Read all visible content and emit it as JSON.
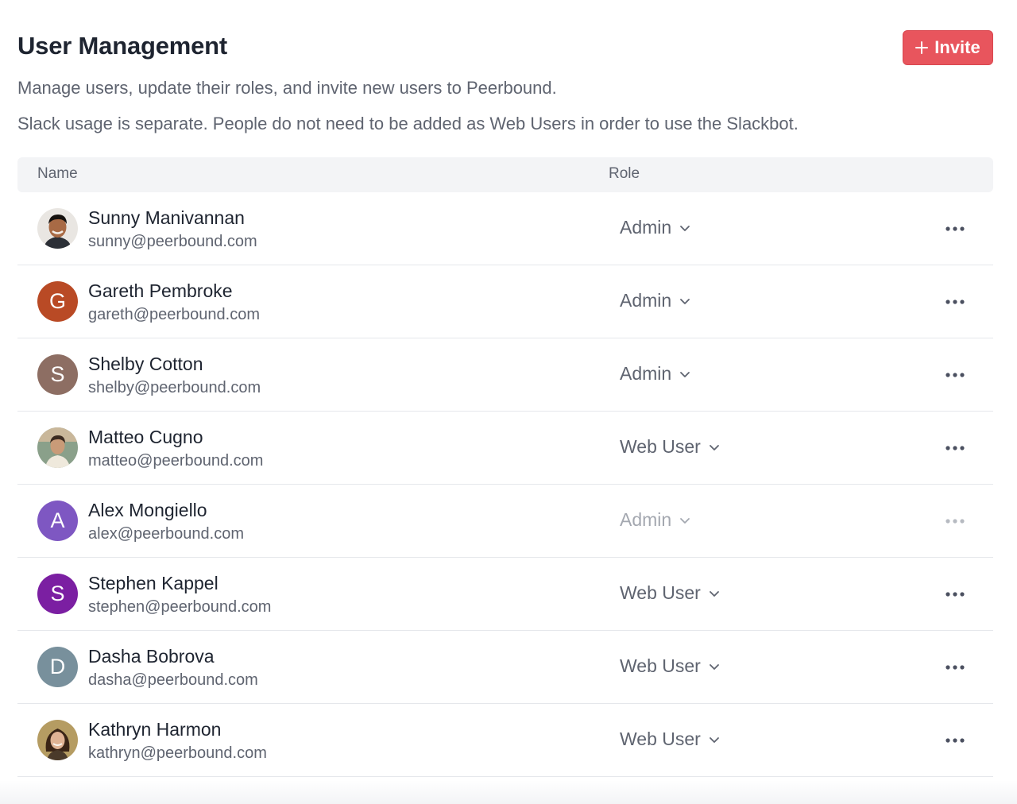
{
  "header": {
    "title": "User Management",
    "invite_label": "Invite",
    "subtitle": "Manage users, update their roles, and invite new users to Peerbound.",
    "note": "Slack usage is separate. People do not need to be added as Web Users in order to use the Slackbot."
  },
  "table": {
    "columns": {
      "name": "Name",
      "role": "Role"
    },
    "rows": [
      {
        "name": "Sunny Manivannan",
        "email": "sunny@peerbound.com",
        "role": "Admin",
        "avatar_type": "photo",
        "avatar_icon": "person-photo-icon",
        "disabled": false
      },
      {
        "name": "Gareth Pembroke",
        "email": "gareth@peerbound.com",
        "role": "Admin",
        "avatar_type": "initial",
        "avatar_initial": "G",
        "avatar_color": "#b94a25",
        "disabled": false
      },
      {
        "name": "Shelby Cotton",
        "email": "shelby@peerbound.com",
        "role": "Admin",
        "avatar_type": "initial",
        "avatar_initial": "S",
        "avatar_color": "#8d6e63",
        "disabled": false
      },
      {
        "name": "Matteo Cugno",
        "email": "matteo@peerbound.com",
        "role": "Web User",
        "avatar_type": "photo",
        "avatar_icon": "person-photo-icon",
        "disabled": false
      },
      {
        "name": "Alex Mongiello",
        "email": "alex@peerbound.com",
        "role": "Admin",
        "avatar_type": "initial",
        "avatar_initial": "A",
        "avatar_color": "#7e57c2",
        "disabled": true
      },
      {
        "name": "Stephen Kappel",
        "email": "stephen@peerbound.com",
        "role": "Web User",
        "avatar_type": "initial",
        "avatar_initial": "S",
        "avatar_color": "#7b1fa2",
        "disabled": false
      },
      {
        "name": "Dasha Bobrova",
        "email": "dasha@peerbound.com",
        "role": "Web User",
        "avatar_type": "initial",
        "avatar_initial": "D",
        "avatar_color": "#78909c",
        "disabled": false
      },
      {
        "name": "Kathryn Harmon",
        "email": "kathryn@peerbound.com",
        "role": "Web User",
        "avatar_type": "photo",
        "avatar_icon": "person-photo-icon",
        "disabled": false
      }
    ]
  },
  "colors": {
    "accent": "#e8555d",
    "text_primary": "#1e2430",
    "text_secondary": "#5f6470",
    "text_disabled": "#a4a8b0",
    "header_bg": "#f3f4f6",
    "divider": "#e5e7eb"
  }
}
